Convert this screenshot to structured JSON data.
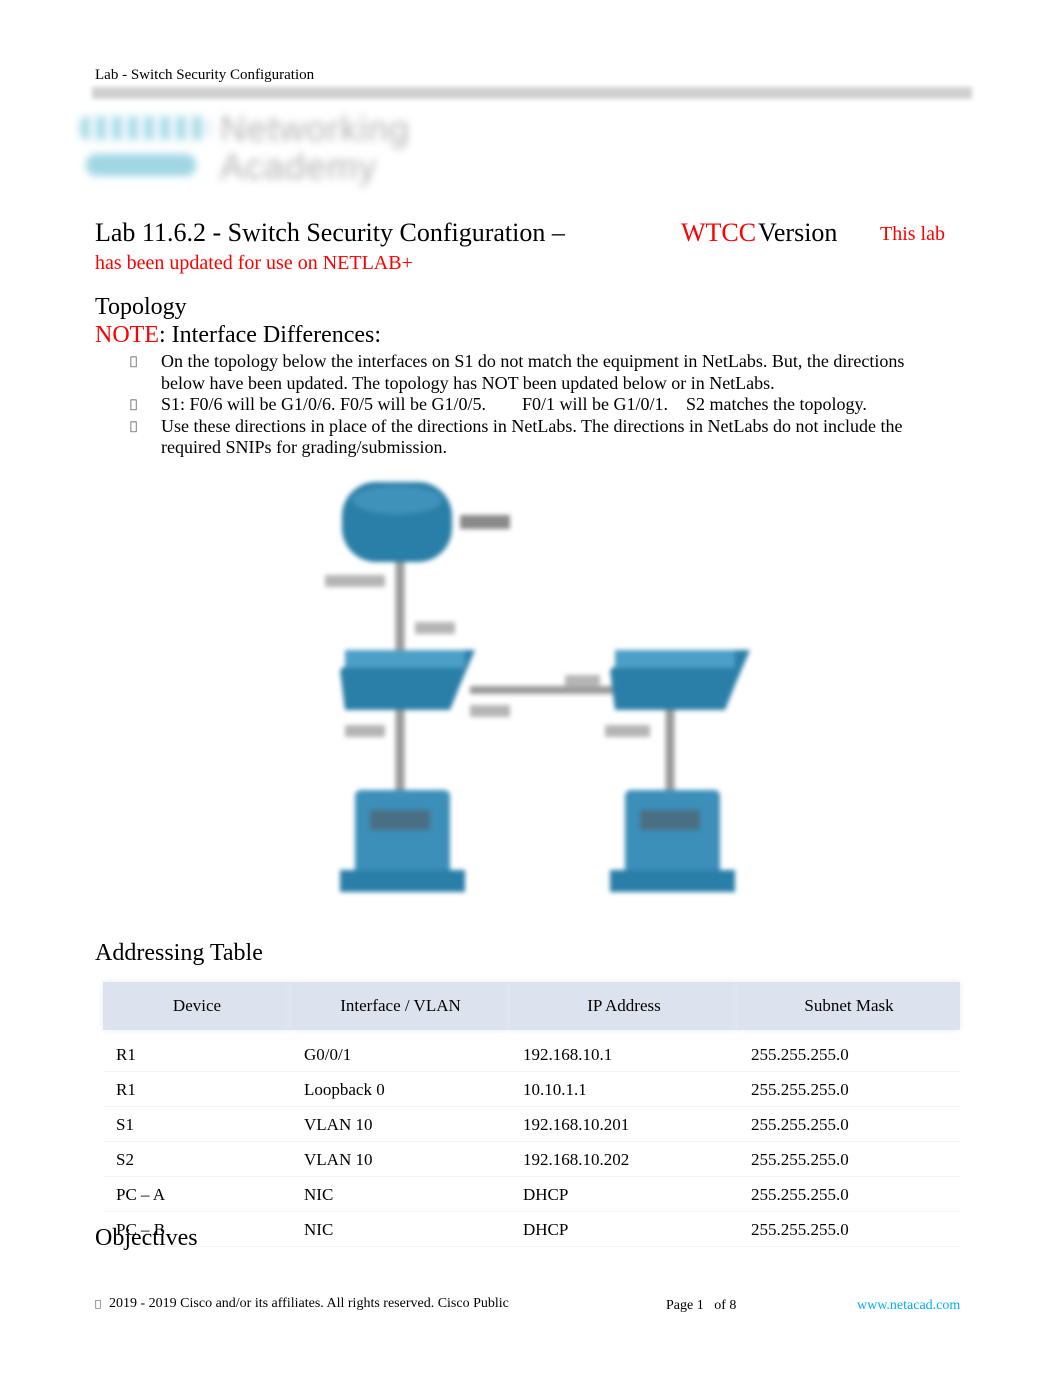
{
  "running_header": "Lab - Switch Security Configuration",
  "logo": {
    "line1": "Networking",
    "line2": "Academy",
    "alt": "Cisco Networking Academy logo"
  },
  "title": {
    "main": "Lab 11.6.2 - Switch Security Configuration –",
    "wtcc": "WTCC",
    "version": "Version",
    "note_start": "This lab",
    "note_rest": "has been updated for use on NETLAB+"
  },
  "sections": {
    "topology": "Topology",
    "note_label": "NOTE",
    "note_text": ": Interface Differences:",
    "addressing": "Addressing Table",
    "objectives": "Objectives"
  },
  "bullets": [
    "On the topology below the interfaces on S1 do not match the equipment in NetLabs. But, the directions below have been updated. The topology has NOT been updated below or in NetLabs.",
    "S1: F0/6 will be G1/0/6. F0/5 will be G1/0/5.        F0/1 will be G1/0/1.    S2 matches the topology.",
    "Use these directions in place of the directions in NetLabs. The directions in NetLabs do not include the required SNIPs for grading/submission."
  ],
  "bullet_glyph": "",
  "topology_devices": [
    "router",
    "switch-left",
    "switch-right",
    "pc-left",
    "pc-right"
  ],
  "addressing_table": {
    "headers": [
      "Device",
      "Interface / VLAN",
      "IP Address",
      "Subnet Mask"
    ],
    "rows": [
      [
        "R1",
        "G0/0/1",
        "192.168.10.1",
        "255.255.255.0"
      ],
      [
        "R1",
        "Loopback 0",
        "10.10.1.1",
        "255.255.255.0"
      ],
      [
        "S1",
        "VLAN 10",
        "192.168.10.201",
        "255.255.255.0"
      ],
      [
        "S2",
        "VLAN 10",
        "192.168.10.202",
        "255.255.255.0"
      ],
      [
        "PC – A",
        "NIC",
        "DHCP",
        "255.255.255.0"
      ],
      [
        "PC – B",
        "NIC",
        "DHCP",
        "255.255.255.0"
      ]
    ]
  },
  "footer": {
    "copyright_glyph": "",
    "copyright": "2019 - 2019 Cisco and/or its affiliates. All rights reserved. Cisco Public",
    "page": "Page 1   of 8",
    "url": "www.netacad.com"
  },
  "colors": {
    "accent_red": "#ff0000",
    "link": "#00aeef",
    "table_header": "#dde3ee",
    "device_blue": "#2a7fa8"
  }
}
